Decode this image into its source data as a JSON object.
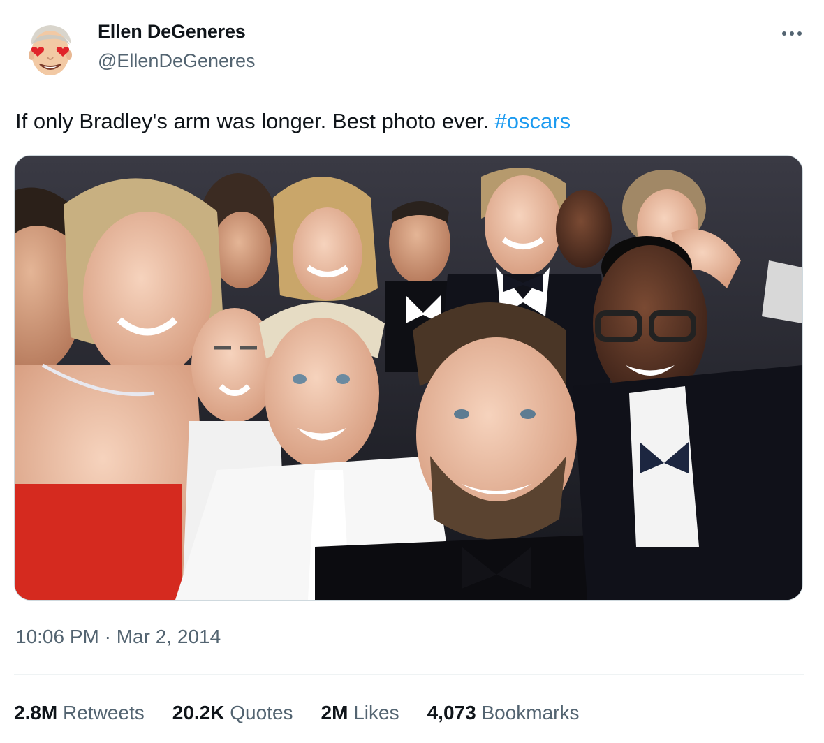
{
  "author": {
    "display_name": "Ellen DeGeneres",
    "handle": "@EllenDeGeneres",
    "avatar_icon": "cartoon-face-heart-eyes-avatar"
  },
  "more_icon": "more-horizontal-icon",
  "tweet": {
    "text": "If only Bradley's arm was longer. Best photo ever. ",
    "hashtag": "#oscars",
    "media_description_icon": "group-selfie-photo"
  },
  "timestamp": "10:06 PM · Mar 2, 2014",
  "stats": {
    "retweets": {
      "count": "2.8M",
      "label": "Retweets"
    },
    "quotes": {
      "count": "20.2K",
      "label": "Quotes"
    },
    "likes": {
      "count": "2M",
      "label": "Likes"
    },
    "bookmarks": {
      "count": "4,073",
      "label": "Bookmarks"
    }
  },
  "colors": {
    "text": "#0f1419",
    "secondary": "#536471",
    "link": "#1d9bf0",
    "border": "#cfd9de"
  }
}
